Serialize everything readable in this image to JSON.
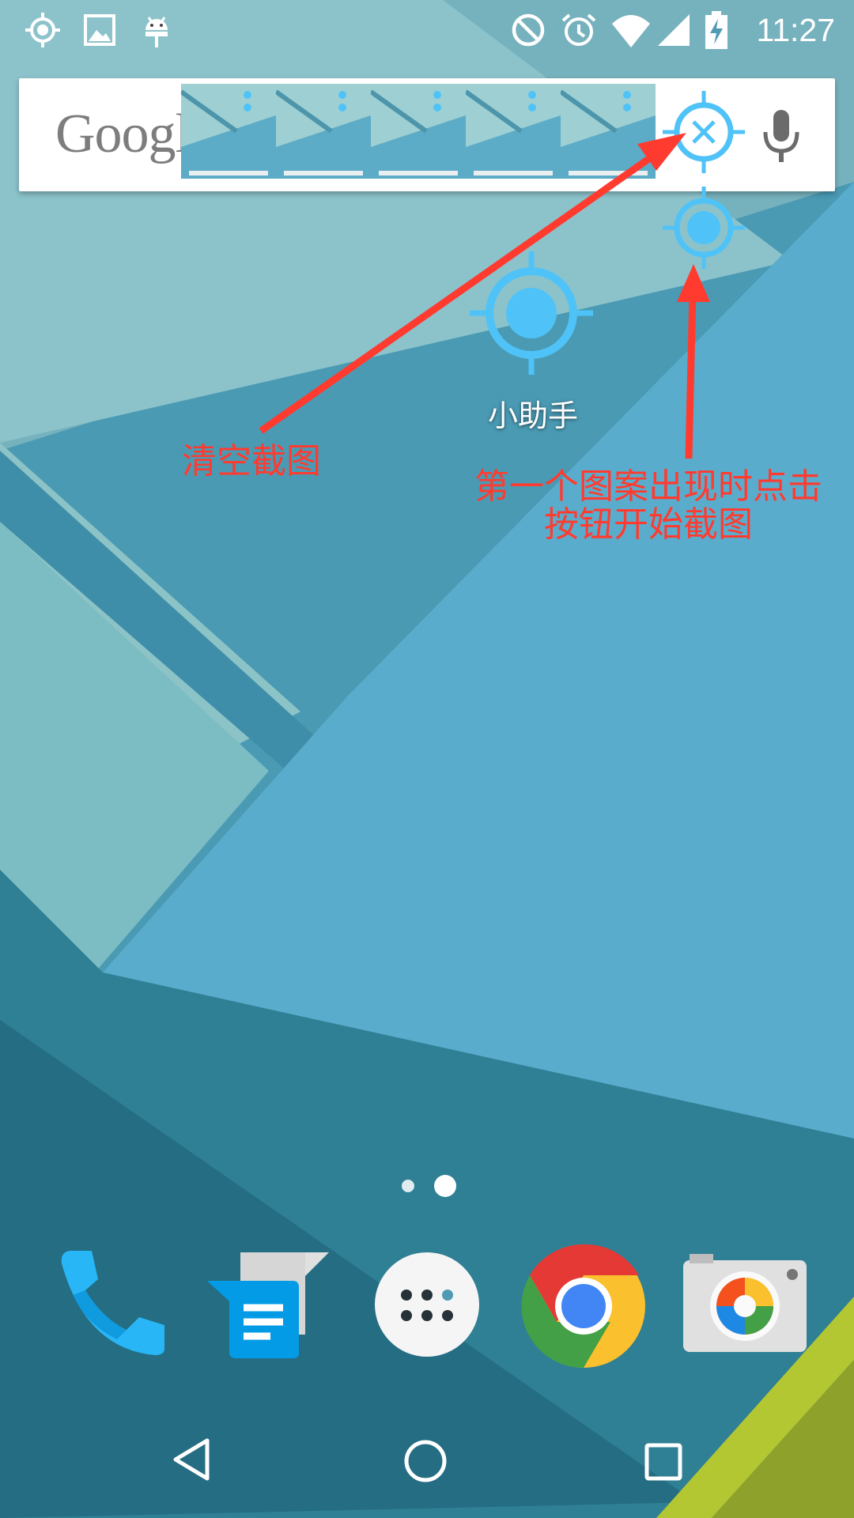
{
  "status_bar": {
    "time": "11:27",
    "left_icons": [
      "gps-icon",
      "image-icon",
      "android-icon"
    ],
    "right_icons": [
      "do-not-disturb-icon",
      "alarm-icon",
      "wifi-icon",
      "cellular-signal-icon",
      "battery-charging-icon"
    ]
  },
  "search_bar": {
    "logo_text": "Google",
    "mic_icon": "microphone-icon",
    "thumbnail_count": 5
  },
  "floating_widgets": {
    "clear_button_icon": "crosshair-close-icon",
    "capture_button_icon": "crosshair-target-icon",
    "assistant_icon": "crosshair-target-icon",
    "assistant_label": "小助手"
  },
  "annotations": {
    "clear_text": "清空截图",
    "start_line1": "第一个图案出现时点击",
    "start_line2": "按钮开始截图",
    "color": "#ff3b30"
  },
  "home": {
    "page_count": 2,
    "current_page": 2
  },
  "dock": {
    "apps": [
      "phone-icon",
      "messenger-icon",
      "app-drawer-icon",
      "chrome-icon",
      "camera-icon"
    ]
  },
  "nav_bar": {
    "buttons": [
      "back-icon",
      "home-icon",
      "recents-icon"
    ]
  },
  "colors": {
    "accent_blue": "#4fc3f7",
    "annotation_red": "#ff3b30"
  }
}
